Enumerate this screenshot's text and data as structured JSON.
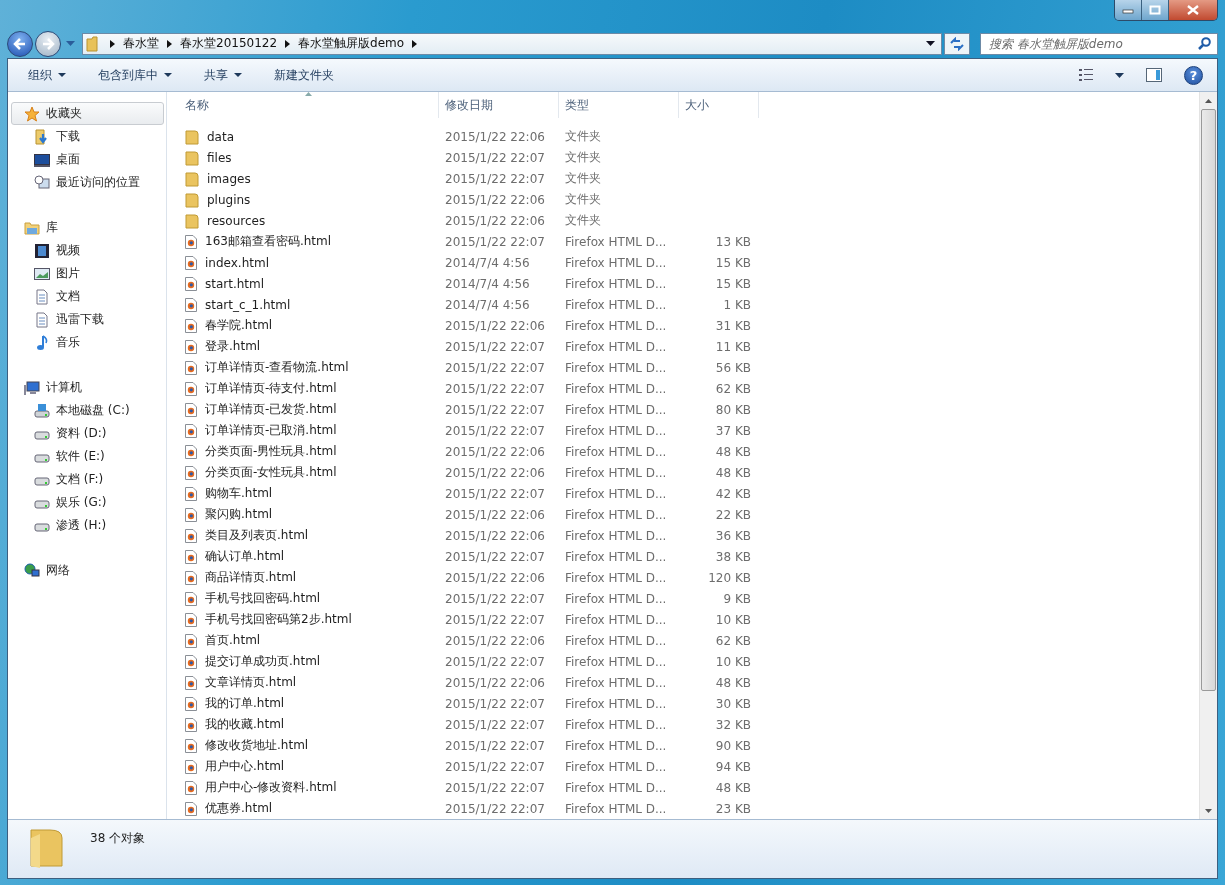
{
  "breadcrumb": [
    "春水堂",
    "春水堂20150122",
    "春水堂触屏版demo"
  ],
  "search": {
    "placeholder": "搜索 春水堂触屏版demo"
  },
  "toolbar": [
    {
      "label": "组织",
      "dropdown": true
    },
    {
      "label": "包含到库中",
      "dropdown": true
    },
    {
      "label": "共享",
      "dropdown": true
    },
    {
      "label": "新建文件夹",
      "dropdown": false
    }
  ],
  "help": "?",
  "sidebar": [
    {
      "label": "收藏夹",
      "kind": "star",
      "selected": true,
      "children": [
        {
          "label": "下载",
          "kind": "download",
          "selected": false
        },
        {
          "label": "桌面",
          "kind": "desktop",
          "selected": false
        },
        {
          "label": "最近访问的位置",
          "kind": "recent",
          "selected": false
        }
      ]
    },
    {
      "label": "库",
      "kind": "library",
      "selected": false,
      "children": [
        {
          "label": "视频",
          "kind": "video",
          "selected": false
        },
        {
          "label": "图片",
          "kind": "picture",
          "selected": false
        },
        {
          "label": "文档",
          "kind": "document",
          "selected": false
        },
        {
          "label": "迅雷下载",
          "kind": "document",
          "selected": false
        },
        {
          "label": "音乐",
          "kind": "music",
          "selected": false
        }
      ]
    },
    {
      "label": "计算机",
      "kind": "computer",
      "selected": false,
      "children": [
        {
          "label": "本地磁盘 (C:)",
          "kind": "system-drive",
          "selected": false
        },
        {
          "label": "资料 (D:)",
          "kind": "drive",
          "selected": false
        },
        {
          "label": "软件 (E:)",
          "kind": "drive",
          "selected": false
        },
        {
          "label": "文档 (F:)",
          "kind": "drive",
          "selected": false
        },
        {
          "label": "娱乐 (G:)",
          "kind": "drive",
          "selected": false
        },
        {
          "label": "渗透 (H:)",
          "kind": "drive",
          "selected": false
        }
      ]
    },
    {
      "label": "网络",
      "kind": "network",
      "selected": false
    }
  ],
  "columns": [
    "名称",
    "修改日期",
    "类型",
    "大小"
  ],
  "files": [
    {
      "name": "data",
      "kind": "folder",
      "date": "2015/1/22 22:06",
      "type": "文件夹"
    },
    {
      "name": "files",
      "kind": "folder",
      "date": "2015/1/22 22:07",
      "type": "文件夹"
    },
    {
      "name": "images",
      "kind": "folder",
      "date": "2015/1/22 22:07",
      "type": "文件夹"
    },
    {
      "name": "plugins",
      "kind": "folder",
      "date": "2015/1/22 22:06",
      "type": "文件夹"
    },
    {
      "name": "resources",
      "kind": "folder",
      "date": "2015/1/22 22:06",
      "type": "文件夹"
    },
    {
      "name": "163邮箱查看密码.html",
      "kind": "html",
      "date": "2015/1/22 22:07",
      "type": "Firefox HTML D...",
      "size": "13 KB"
    },
    {
      "name": "index.html",
      "kind": "html",
      "date": "2014/7/4 4:56",
      "type": "Firefox HTML D...",
      "size": "15 KB"
    },
    {
      "name": "start.html",
      "kind": "html",
      "date": "2014/7/4 4:56",
      "type": "Firefox HTML D...",
      "size": "15 KB"
    },
    {
      "name": "start_c_1.html",
      "kind": "html",
      "date": "2014/7/4 4:56",
      "type": "Firefox HTML D...",
      "size": "1 KB"
    },
    {
      "name": "春学院.html",
      "kind": "html",
      "date": "2015/1/22 22:06",
      "type": "Firefox HTML D...",
      "size": "31 KB"
    },
    {
      "name": "登录.html",
      "kind": "html",
      "date": "2015/1/22 22:07",
      "type": "Firefox HTML D...",
      "size": "11 KB"
    },
    {
      "name": "订单详情页-查看物流.html",
      "kind": "html",
      "date": "2015/1/22 22:07",
      "type": "Firefox HTML D...",
      "size": "56 KB"
    },
    {
      "name": "订单详情页-待支付.html",
      "kind": "html",
      "date": "2015/1/22 22:07",
      "type": "Firefox HTML D...",
      "size": "62 KB"
    },
    {
      "name": "订单详情页-已发货.html",
      "kind": "html",
      "date": "2015/1/22 22:07",
      "type": "Firefox HTML D...",
      "size": "80 KB"
    },
    {
      "name": "订单详情页-已取消.html",
      "kind": "html",
      "date": "2015/1/22 22:07",
      "type": "Firefox HTML D...",
      "size": "37 KB"
    },
    {
      "name": "分类页面-男性玩具.html",
      "kind": "html",
      "date": "2015/1/22 22:06",
      "type": "Firefox HTML D...",
      "size": "48 KB"
    },
    {
      "name": "分类页面-女性玩具.html",
      "kind": "html",
      "date": "2015/1/22 22:06",
      "type": "Firefox HTML D...",
      "size": "48 KB"
    },
    {
      "name": "购物车.html",
      "kind": "html",
      "date": "2015/1/22 22:07",
      "type": "Firefox HTML D...",
      "size": "42 KB"
    },
    {
      "name": "聚闪购.html",
      "kind": "html",
      "date": "2015/1/22 22:06",
      "type": "Firefox HTML D...",
      "size": "22 KB"
    },
    {
      "name": "类目及列表页.html",
      "kind": "html",
      "date": "2015/1/22 22:06",
      "type": "Firefox HTML D...",
      "size": "36 KB"
    },
    {
      "name": "确认订单.html",
      "kind": "html",
      "date": "2015/1/22 22:07",
      "type": "Firefox HTML D...",
      "size": "38 KB"
    },
    {
      "name": "商品详情页.html",
      "kind": "html",
      "date": "2015/1/22 22:06",
      "type": "Firefox HTML D...",
      "size": "120 KB"
    },
    {
      "name": "手机号找回密码.html",
      "kind": "html",
      "date": "2015/1/22 22:07",
      "type": "Firefox HTML D...",
      "size": "9 KB"
    },
    {
      "name": "手机号找回密码第2步.html",
      "kind": "html",
      "date": "2015/1/22 22:07",
      "type": "Firefox HTML D...",
      "size": "10 KB"
    },
    {
      "name": "首页.html",
      "kind": "html",
      "date": "2015/1/22 22:06",
      "type": "Firefox HTML D...",
      "size": "62 KB"
    },
    {
      "name": "提交订单成功页.html",
      "kind": "html",
      "date": "2015/1/22 22:07",
      "type": "Firefox HTML D...",
      "size": "10 KB"
    },
    {
      "name": "文章详情页.html",
      "kind": "html",
      "date": "2015/1/22 22:06",
      "type": "Firefox HTML D...",
      "size": "48 KB"
    },
    {
      "name": "我的订单.html",
      "kind": "html",
      "date": "2015/1/22 22:07",
      "type": "Firefox HTML D...",
      "size": "30 KB"
    },
    {
      "name": "我的收藏.html",
      "kind": "html",
      "date": "2015/1/22 22:07",
      "type": "Firefox HTML D...",
      "size": "32 KB"
    },
    {
      "name": "修改收货地址.html",
      "kind": "html",
      "date": "2015/1/22 22:07",
      "type": "Firefox HTML D...",
      "size": "90 KB"
    },
    {
      "name": "用户中心.html",
      "kind": "html",
      "date": "2015/1/22 22:07",
      "type": "Firefox HTML D...",
      "size": "94 KB"
    },
    {
      "name": "用户中心-修改资料.html",
      "kind": "html",
      "date": "2015/1/22 22:07",
      "type": "Firefox HTML D...",
      "size": "48 KB"
    },
    {
      "name": "优惠券.html",
      "kind": "html",
      "date": "2015/1/22 22:07",
      "type": "Firefox HTML D...",
      "size": "23 KB"
    }
  ],
  "status": {
    "count": "38 个对象"
  }
}
